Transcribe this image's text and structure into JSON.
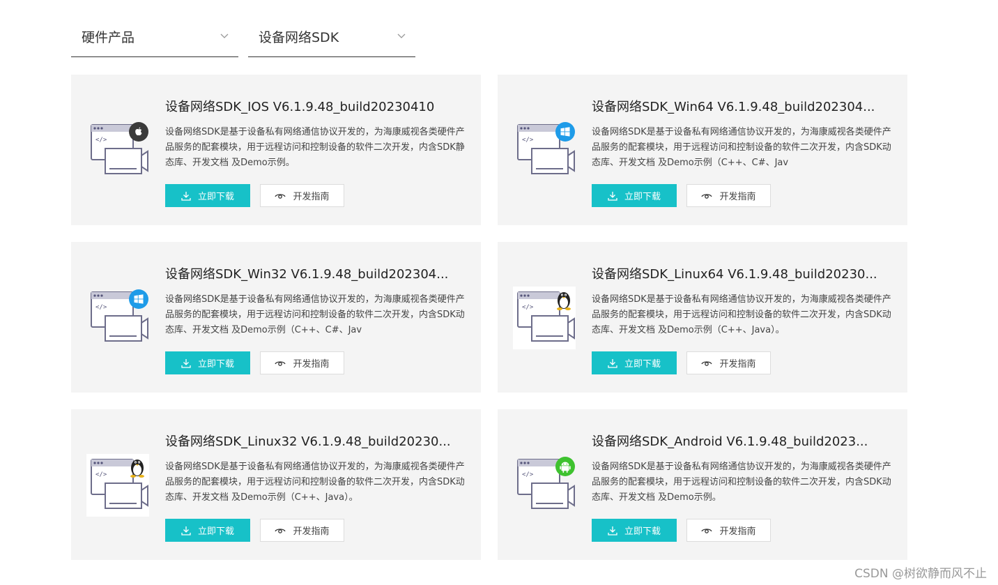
{
  "filters": [
    {
      "label": "硬件产品",
      "icon": "chevron-down-icon"
    },
    {
      "label": "设备网络SDK",
      "icon": "chevron-down-icon"
    }
  ],
  "cards": [
    {
      "title": "设备网络SDK_IOS V6.1.9.48_build20230410",
      "description": "设备网络SDK是基于设备私有网络通信协议开发的，为海康威视各类硬件产品服务的配套模块，用于远程访问和控制设备的软件二次开发，内含SDK静态库、开发文档 及Demo示例。",
      "platform_icon": "apple-icon",
      "download_label": "立即下载",
      "guide_label": "开发指南"
    },
    {
      "title": "设备网络SDK_Win64 V6.1.9.48_build202304...",
      "description": "设备网络SDK是基于设备私有网络通信协议开发的，为海康威视各类硬件产品服务的配套模块，用于远程访问和控制设备的软件二次开发，内含SDK动态库、开发文档 及Demo示例（C++、C#、Jav",
      "platform_icon": "windows-icon",
      "download_label": "立即下载",
      "guide_label": "开发指南"
    },
    {
      "title": "设备网络SDK_Win32 V6.1.9.48_build202304...",
      "description": "设备网络SDK是基于设备私有网络通信协议开发的，为海康威视各类硬件产品服务的配套模块，用于远程访问和控制设备的软件二次开发，内含SDK动态库、开发文档 及Demo示例（C++、C#、Jav",
      "platform_icon": "windows-icon",
      "download_label": "立即下载",
      "guide_label": "开发指南"
    },
    {
      "title": "设备网络SDK_Linux64 V6.1.9.48_build20230...",
      "description": "设备网络SDK是基于设备私有网络通信协议开发的，为海康威视各类硬件产品服务的配套模块，用于远程访问和控制设备的软件二次开发，内含SDK动态库、开发文档 及Demo示例（C++、Java）。",
      "platform_icon": "linux-penguin-icon",
      "download_label": "立即下载",
      "guide_label": "开发指南"
    },
    {
      "title": "设备网络SDK_Linux32 V6.1.9.48_build20230...",
      "description": "设备网络SDK是基于设备私有网络通信协议开发的，为海康威视各类硬件产品服务的配套模块，用于远程访问和控制设备的软件二次开发，内含SDK动态库、开发文档 及Demo示例（C++、Java）。",
      "platform_icon": "linux-penguin-icon",
      "download_label": "立即下载",
      "guide_label": "开发指南"
    },
    {
      "title": "设备网络SDK_Android V6.1.9.48_build2023...",
      "description": "设备网络SDK是基于设备私有网络通信协议开发的，为海康威视各类硬件产品服务的配套模块，用于远程访问和控制设备的软件二次开发，内含SDK动态库、开发文档 及Demo示例。",
      "platform_icon": "android-icon",
      "download_label": "立即下载",
      "guide_label": "开发指南"
    }
  ],
  "watermark": "CSDN @树欲静而风不止",
  "colors": {
    "accent": "#17c1c8",
    "card_bg": "#f4f4f4",
    "apple_badge": "#3a3a3a",
    "windows_badge": "#1e9be8",
    "android_badge": "#3ec22f"
  }
}
